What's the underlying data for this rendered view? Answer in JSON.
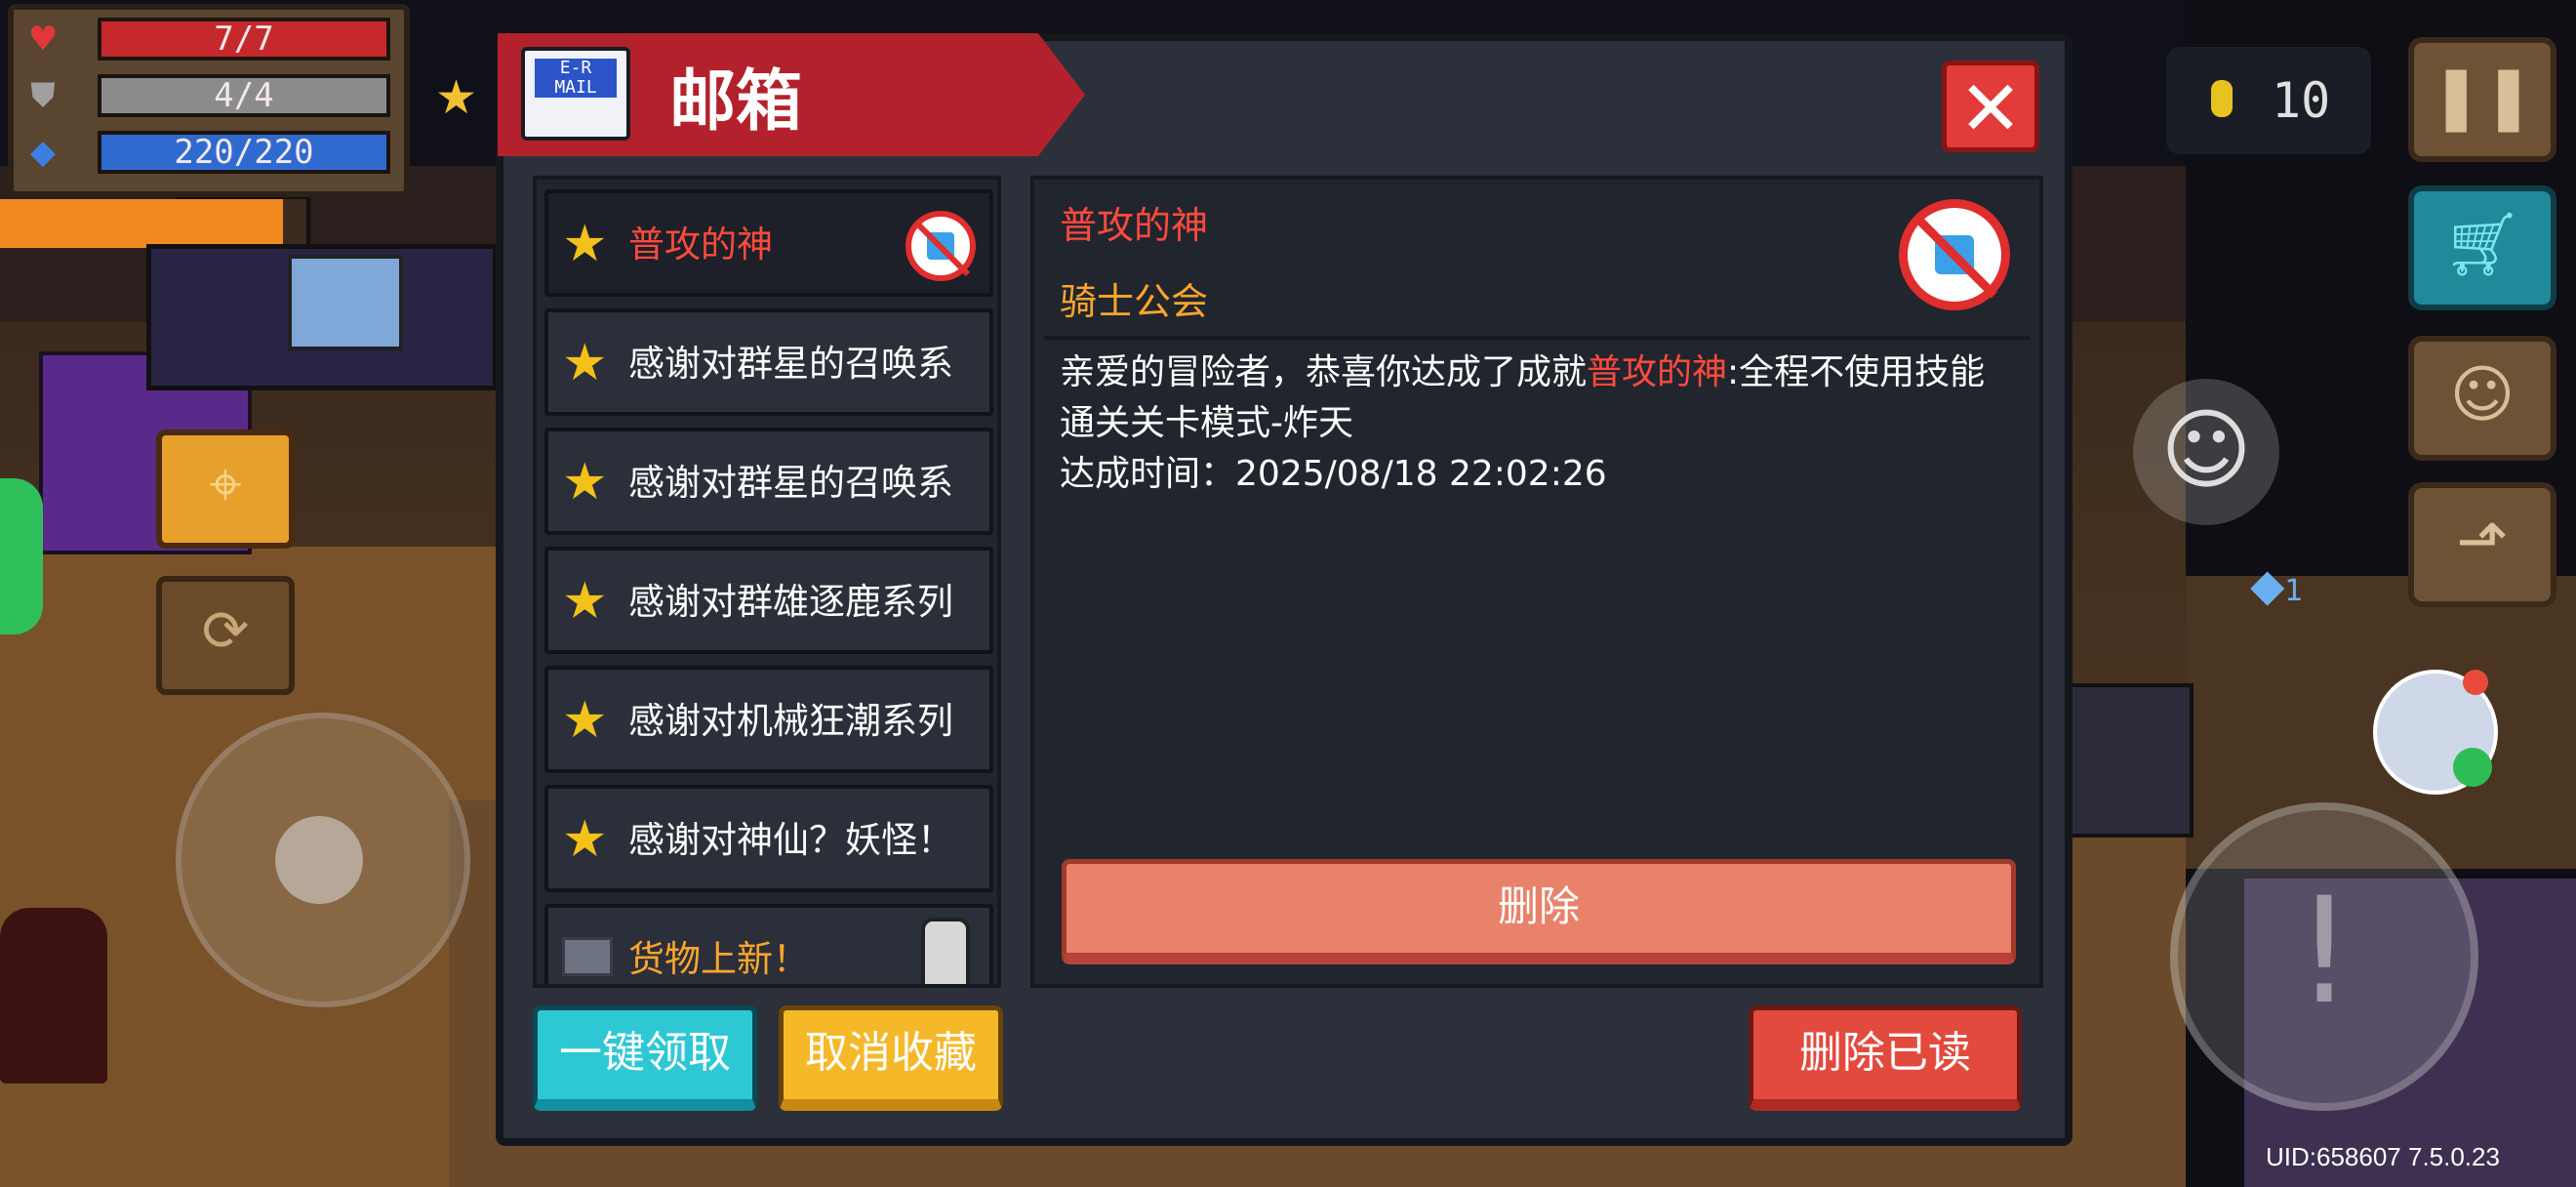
{
  "hud": {
    "hp": "7/7",
    "armor": "4/4",
    "energy": "220/220",
    "coins": "10",
    "uid_version": "UID:658607 7.5.0.23",
    "level": "1"
  },
  "mailbox": {
    "title": "邮箱",
    "mail_list": [
      {
        "label": "普攻的神",
        "kind": "star",
        "selected": true,
        "color": "red"
      },
      {
        "label": "感谢对群星的召唤系",
        "kind": "star"
      },
      {
        "label": "感谢对群星的召唤系",
        "kind": "star"
      },
      {
        "label": "感谢对群雄逐鹿系列",
        "kind": "star"
      },
      {
        "label": "感谢对机械狂潮系列",
        "kind": "star"
      },
      {
        "label": "感谢对神仙？妖怪！",
        "kind": "star"
      },
      {
        "label": "货物上新！",
        "kind": "envelope",
        "color": "orange"
      }
    ],
    "detail": {
      "title": "普攻的神",
      "sender": "骑士公会",
      "body_prefix": "亲爱的冒险者，恭喜你达成了成就",
      "body_highlight": "普攻的神",
      "body_suffix": ":全程不使用技能通关关卡模式-炸天",
      "time_label": "达成时间：",
      "time_value": "2025/08/18 22:02:26",
      "delete_label": "删除"
    },
    "buttons": {
      "claim_all": "一键领取",
      "unfavorite": "取消收藏",
      "delete_read": "删除已读"
    },
    "icons": {
      "close": "close-icon",
      "mail": "mail-icon",
      "star": "star-icon"
    },
    "colors": {
      "header_red": "#b3222c",
      "highlight_red": "#ff4a3e",
      "sender_orange": "#ffa62b",
      "claim_cyan": "#2ec8d4",
      "unfav_yellow": "#f5b829",
      "delete_red": "#e24a3e"
    }
  }
}
